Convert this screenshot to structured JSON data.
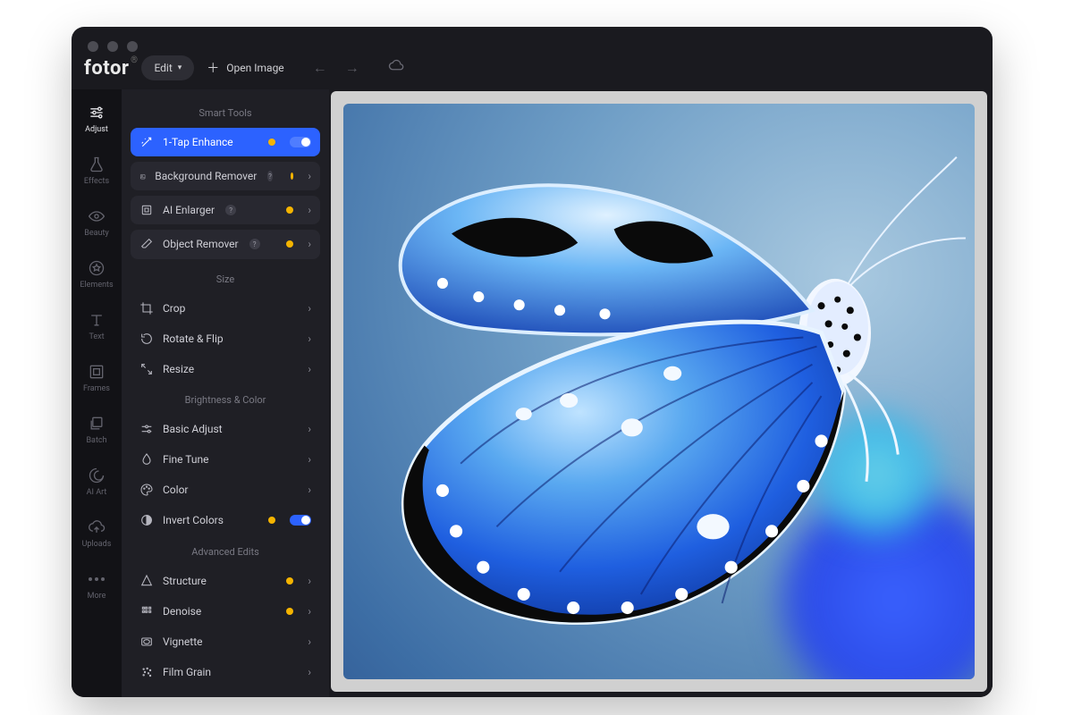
{
  "app": {
    "logo": "fotor"
  },
  "topbar": {
    "edit_label": "Edit",
    "open_image_label": "Open Image"
  },
  "rail": {
    "items": [
      {
        "label": "Adjust"
      },
      {
        "label": "Effects"
      },
      {
        "label": "Beauty"
      },
      {
        "label": "Elements"
      },
      {
        "label": "Text"
      },
      {
        "label": "Frames"
      },
      {
        "label": "Batch"
      },
      {
        "label": "AI Art"
      },
      {
        "label": "Uploads"
      },
      {
        "label": "More"
      }
    ]
  },
  "panel": {
    "sections": {
      "smart_tools": {
        "title": "Smart Tools",
        "items": [
          {
            "label": "1-Tap Enhance"
          },
          {
            "label": "Background Remover"
          },
          {
            "label": "AI Enlarger"
          },
          {
            "label": "Object Remover"
          }
        ]
      },
      "size": {
        "title": "Size",
        "items": [
          {
            "label": "Crop"
          },
          {
            "label": "Rotate & Flip"
          },
          {
            "label": "Resize"
          }
        ]
      },
      "brightness_color": {
        "title": "Brightness & Color",
        "items": [
          {
            "label": "Basic Adjust"
          },
          {
            "label": "Fine Tune"
          },
          {
            "label": "Color"
          },
          {
            "label": "Invert Colors"
          }
        ]
      },
      "advanced": {
        "title": "Advanced Edits",
        "items": [
          {
            "label": "Structure"
          },
          {
            "label": "Denoise"
          },
          {
            "label": "Vignette"
          },
          {
            "label": "Film Grain"
          }
        ]
      }
    }
  },
  "colors": {
    "accent": "#2c62ff",
    "premium": "#f5b400"
  }
}
